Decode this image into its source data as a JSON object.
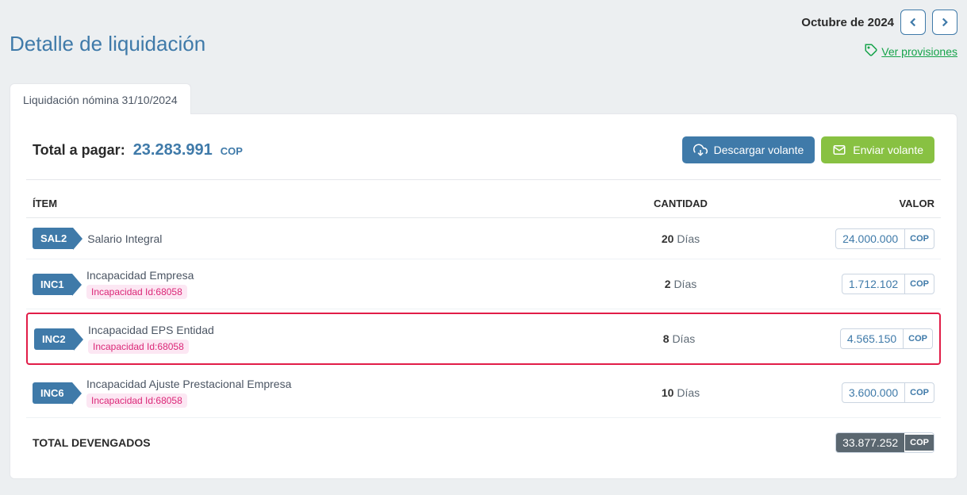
{
  "header": {
    "title": "Detalle de liquidación",
    "period_label": "Octubre de 2024",
    "provisions_link": "Ver provisiones"
  },
  "tabs": {
    "active_label": "Liquidación nómina 31/10/2024"
  },
  "summary": {
    "label": "Total a pagar:",
    "value": "23.283.991",
    "currency": "COP",
    "download_btn": "Descargar volante",
    "send_btn": "Enviar volante"
  },
  "table": {
    "columns": {
      "item": "ÍTEM",
      "qty": "CANTIDAD",
      "value": "VALOR"
    },
    "qty_unit": "Días",
    "currency": "COP",
    "rows": [
      {
        "code": "SAL2",
        "name": "Salario Integral",
        "sub": "",
        "qty": "20",
        "value": "24.000.000",
        "highlight": false
      },
      {
        "code": "INC1",
        "name": "Incapacidad Empresa",
        "sub": "Incapacidad Id:68058",
        "qty": "2",
        "value": "1.712.102",
        "highlight": false
      },
      {
        "code": "INC2",
        "name": "Incapacidad EPS Entidad",
        "sub": "Incapacidad Id:68058",
        "qty": "8",
        "value": "4.565.150",
        "highlight": true
      },
      {
        "code": "INC6",
        "name": "Incapacidad Ajuste Prestacional Empresa",
        "sub": "Incapacidad Id:68058",
        "qty": "10",
        "value": "3.600.000",
        "highlight": false
      }
    ],
    "total": {
      "label": "TOTAL DEVENGADOS",
      "value": "33.877.252",
      "currency": "COP"
    }
  }
}
